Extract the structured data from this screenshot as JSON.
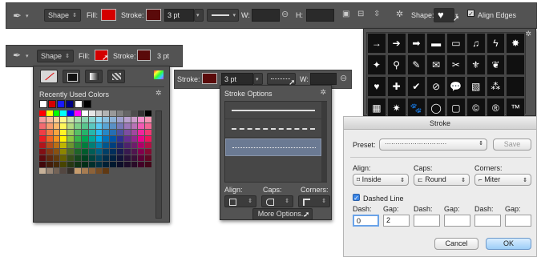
{
  "toolbar": {
    "shape_mode": "Shape",
    "fill_label": "Fill:",
    "stroke_label": "Stroke:",
    "stroke_width": "3 pt",
    "w_label": "W:",
    "h_label": "H:",
    "shape_label": "Shape:",
    "align_edges_label": "Align Edges"
  },
  "fill_panel": {
    "recently_used_label": "Recently Used Colors"
  },
  "stroke_options": {
    "title": "Stroke Options",
    "align_label": "Align:",
    "caps_label": "Caps:",
    "corners_label": "Corners:",
    "more_options_label": "More Options..."
  },
  "shape_picker": {
    "glyphs": [
      "→",
      "➔",
      "➡",
      "▬",
      "▭",
      "♫",
      "ϟ",
      "✸",
      "✦",
      "⚲",
      "✎",
      "✉",
      "✂",
      "⚜",
      "❦",
      "",
      "♥",
      "✚",
      "✔",
      "⊘",
      "💬",
      "▧",
      "⁂",
      "",
      "▦",
      "✷",
      "🐾",
      "◯",
      "▢",
      "©",
      "®",
      "™"
    ]
  },
  "stroke_dialog": {
    "title": "Stroke",
    "preset_label": "Preset:",
    "preset_value": "·····························",
    "save_label": "Save",
    "align_label": "Align:",
    "align_value": "Inside",
    "caps_label": "Caps:",
    "caps_value": "Round",
    "corners_label": "Corners:",
    "corners_value": "Miter",
    "dashed_line_label": "Dashed Line",
    "dash_labels": [
      "Dash:",
      "Gap:",
      "Dash:",
      "Gap:",
      "Dash:",
      "Gap:"
    ],
    "dash_values": [
      "0",
      "2",
      "",
      "",
      "",
      ""
    ],
    "cancel_label": "Cancel",
    "ok_label": "OK"
  },
  "colors": {
    "fill": "#d40000",
    "stroke": "#5a0a0a",
    "panel_bg": "#535353",
    "ok_button": "#bfe1ff"
  }
}
